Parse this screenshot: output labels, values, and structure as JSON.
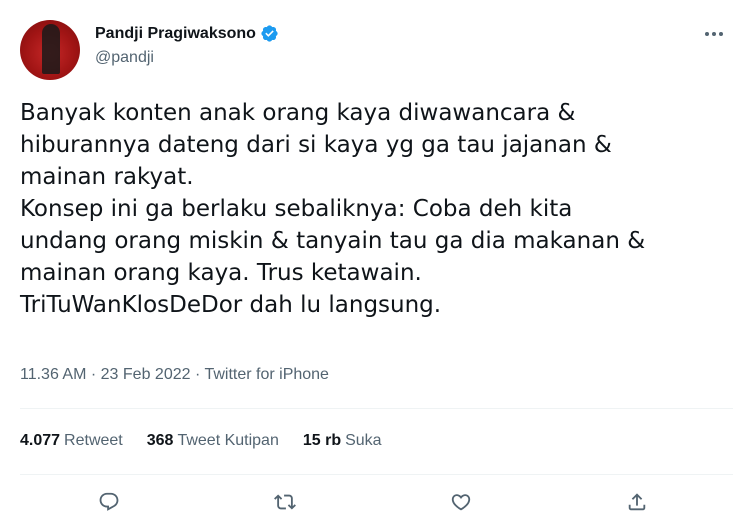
{
  "author": {
    "display_name": "Pandji Pragiwaksono",
    "handle": "@pandji",
    "verified": true,
    "avatar_icon": "avatar"
  },
  "more_icon": "more-icon",
  "tweet": {
    "text": "Banyak konten anak orang kaya diwawancara &\nhiburannya dateng dari si kaya yg ga tau jajanan &\nmainan rakyat.\nKonsep ini ga berlaku sebaliknya: Coba deh kita\nundang orang miskin & tanyain tau ga dia makanan &\nmainan orang kaya. Trus ketawain.\nTriTuWanKlosDeDor dah lu langsung."
  },
  "meta": {
    "time": "11.36 AM",
    "separator": "·",
    "date": "23 Feb 2022",
    "source": "Twitter for iPhone"
  },
  "stats": {
    "retweets_count": "4.077",
    "retweets_label": "Retweet",
    "quotes_count": "368",
    "quotes_label": "Tweet Kutipan",
    "likes_count": "15 rb",
    "likes_label": "Suka"
  },
  "actions": [
    "reply-icon",
    "retweet-icon",
    "like-icon",
    "share-icon"
  ],
  "colors": {
    "text": "#0f1419",
    "secondary": "#536471",
    "verified": "#1d9bf0",
    "divider": "#eff3f4"
  }
}
